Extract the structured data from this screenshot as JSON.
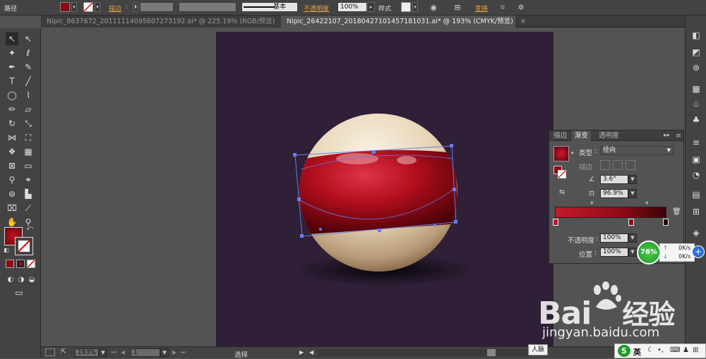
{
  "control_bar": {
    "path_label": "路径",
    "stroke_label": "描边",
    "stroke_style_label": "基本",
    "opacity_label": "不透明度",
    "opacity_value": "100%",
    "style_label": "样式",
    "transform_label": "变换",
    "fill_color": "#8b0d14"
  },
  "tabs": [
    {
      "label": "Nipic_8637672_20111114095607273192.ai* @ 225.19% (RGB/预览)",
      "close": "×"
    },
    {
      "label": "Nipic_26422107_20180427101457181031.ai* @ 193% (CMYK/预览)",
      "close": "×"
    }
  ],
  "gradient_panel": {
    "tabs": [
      "描边",
      "渐变",
      "透明度"
    ],
    "type_label": "类型",
    "type_value": "径向",
    "stroke_label": "描边",
    "angle_value": "3.6°",
    "aspect_value": "96.9%",
    "opacity_label": "不透明度",
    "opacity_value": "100%",
    "location_label": "位置",
    "location_value": "100%"
  },
  "status_bar": {
    "zoom": "193%",
    "page": "1",
    "tool_label": "选择",
    "tooltip": "人脉"
  },
  "network_widget": {
    "percent": "76%",
    "up_speed": "0K/s",
    "down_speed": "0K/s"
  },
  "watermark": {
    "brand": "Bai",
    "brand_suffix": "经验",
    "url": "jingyan.baidu.com"
  },
  "ime": {
    "lang": "英"
  }
}
